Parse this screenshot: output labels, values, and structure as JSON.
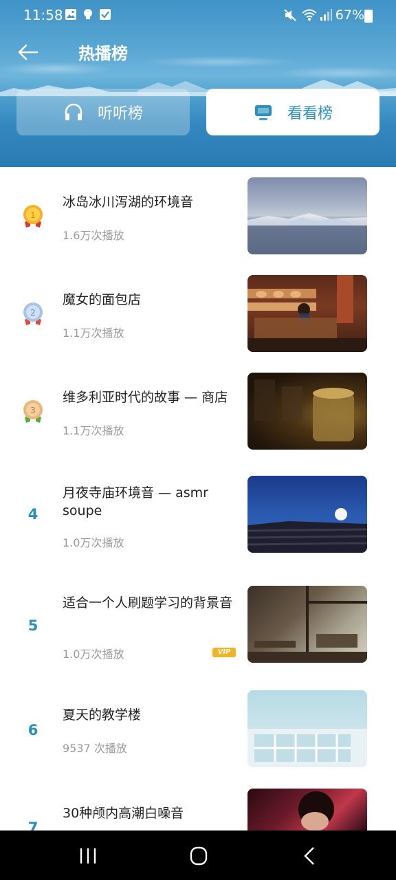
{
  "status_bar": {
    "time": "11:58",
    "battery": "67%"
  },
  "header": {
    "title": "热播榜",
    "tabs": [
      {
        "label": "听听榜",
        "icon": "headphones-icon",
        "selected": false
      },
      {
        "label": "看看榜",
        "icon": "monitor-icon",
        "selected": true
      }
    ]
  },
  "list": {
    "items": [
      {
        "rank": "1",
        "medal": "gold",
        "title": "冰岛冰川泻湖的环境音",
        "plays": "1.6万次播放",
        "vip": false
      },
      {
        "rank": "2",
        "medal": "silver",
        "title": "魔女的面包店",
        "plays": "1.1万次播放",
        "vip": false
      },
      {
        "rank": "3",
        "medal": "bronze",
        "title": "维多利亚时代的故事 — 商店",
        "plays": "1.1万次播放",
        "vip": false
      },
      {
        "rank": "4",
        "title": "月夜寺庙环境音 — asmr soupe",
        "plays": "1.0万次播放",
        "vip": false
      },
      {
        "rank": "5",
        "title": "适合一个人刷题学习的背景音",
        "plays": "1.0万次播放",
        "vip": true,
        "vip_label": "VIP"
      },
      {
        "rank": "6",
        "title": "夏天的教学楼",
        "plays": "9537 次播放",
        "vip": false
      },
      {
        "rank": "7",
        "title": "30种颅内高潮白噪音",
        "plays": "",
        "vip": false
      }
    ]
  },
  "colors": {
    "accent": "#2a8fbd",
    "vip": "#f0b526",
    "header_sky": "#3f93c6"
  }
}
